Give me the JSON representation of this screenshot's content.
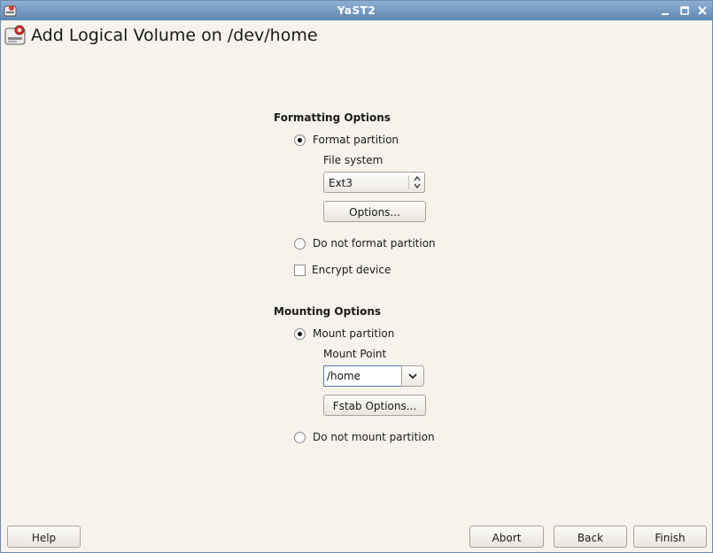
{
  "window": {
    "title": "YaST2",
    "controls": [
      "minimize-icon",
      "maximize-icon",
      "close-icon"
    ]
  },
  "header": {
    "title": "Add Logical Volume on /dev/home",
    "icon": "disk-partition-icon"
  },
  "formatting": {
    "section_title": "Formatting Options",
    "format_partition": {
      "label": "Format partition",
      "selected": true
    },
    "file_system": {
      "label": "File system",
      "value": "Ext3"
    },
    "options_button": "Options...",
    "do_not_format": {
      "label": "Do not format partition",
      "selected": false
    },
    "encrypt_device": {
      "label": "Encrypt device",
      "checked": false
    }
  },
  "mounting": {
    "section_title": "Mounting Options",
    "mount_partition": {
      "label": "Mount partition",
      "selected": true
    },
    "mount_point": {
      "label": "Mount Point",
      "value": "/home"
    },
    "fstab_button": "Fstab Options...",
    "do_not_mount": {
      "label": "Do not mount partition",
      "selected": false
    }
  },
  "footer": {
    "help": "Help",
    "abort": "Abort",
    "back": "Back",
    "finish": "Finish"
  }
}
